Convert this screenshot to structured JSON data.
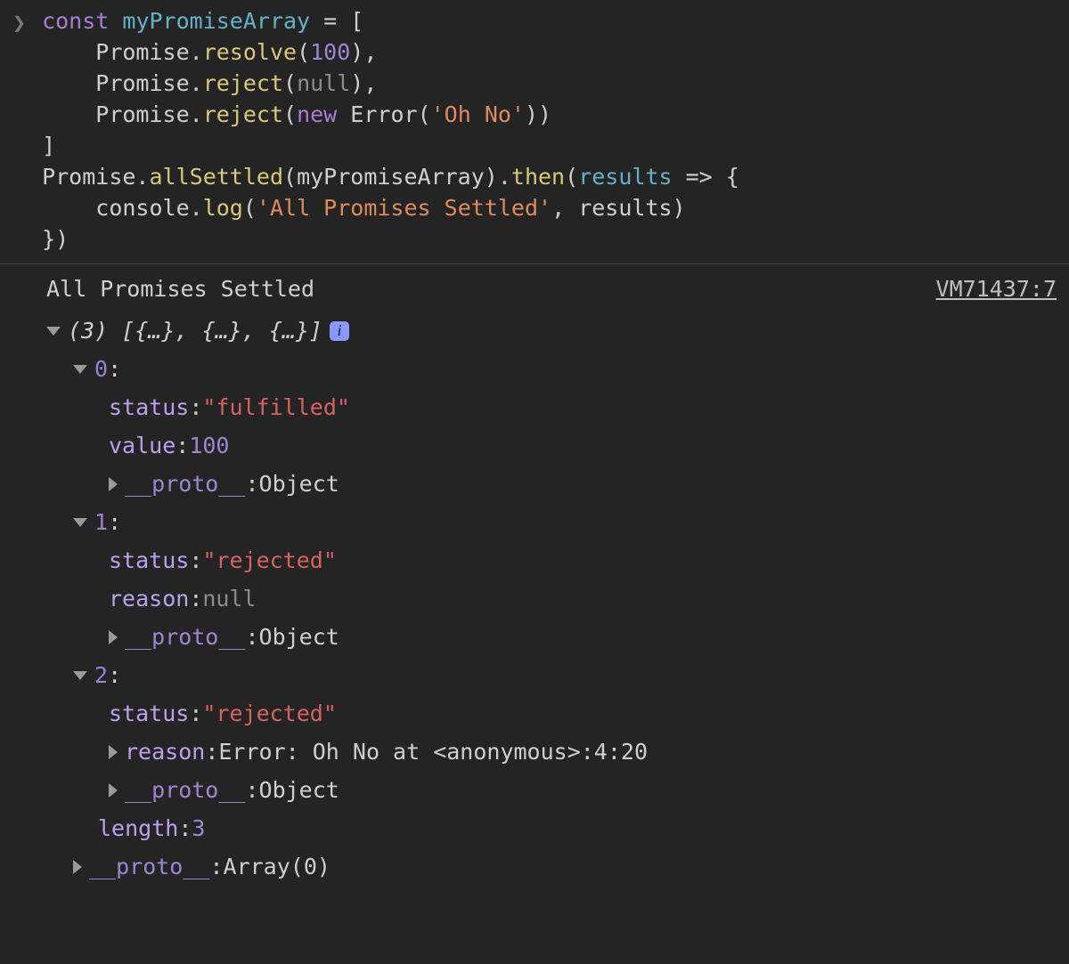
{
  "input": {
    "code": {
      "kw_const": "const",
      "var": "myPromiseArray",
      "eq": " = ",
      "lbracket": "[",
      "promise": "Promise",
      "dot": ".",
      "resolve": "resolve",
      "reject": "reject",
      "lp": "(",
      "rp": ")",
      "comma": ",",
      "n100": "100",
      "null": "null",
      "new": "new",
      "Error": "Error",
      "ohno": "'Oh No'",
      "rbracket": "]",
      "allSettled": "allSettled",
      "then": "then",
      "results": "results",
      "arrow": " => ",
      "lbrace": "{",
      "rbrace": "}",
      "console": "console",
      "log": "log",
      "logstr": "'All Promises Settled'",
      "results2": "results"
    }
  },
  "output": {
    "message": "All Promises Settled",
    "source": "VM71437:7",
    "array_summary": "(3) [{…}, {…}, {…}]",
    "info_icon": "i",
    "items": {
      "idx0": "0",
      "idx1": "1",
      "idx2": "2",
      "status_key": "status",
      "value_key": "value",
      "reason_key": "reason",
      "proto_key": "__proto__",
      "length_key": "length",
      "fulfilled": "\"fulfilled\"",
      "rejected": "\"rejected\"",
      "val100": "100",
      "valnull": "null",
      "err": "Error: Oh No at <anonymous>:4:20",
      "Object": "Object",
      "len3": "3",
      "Array0": "Array(0)"
    }
  }
}
